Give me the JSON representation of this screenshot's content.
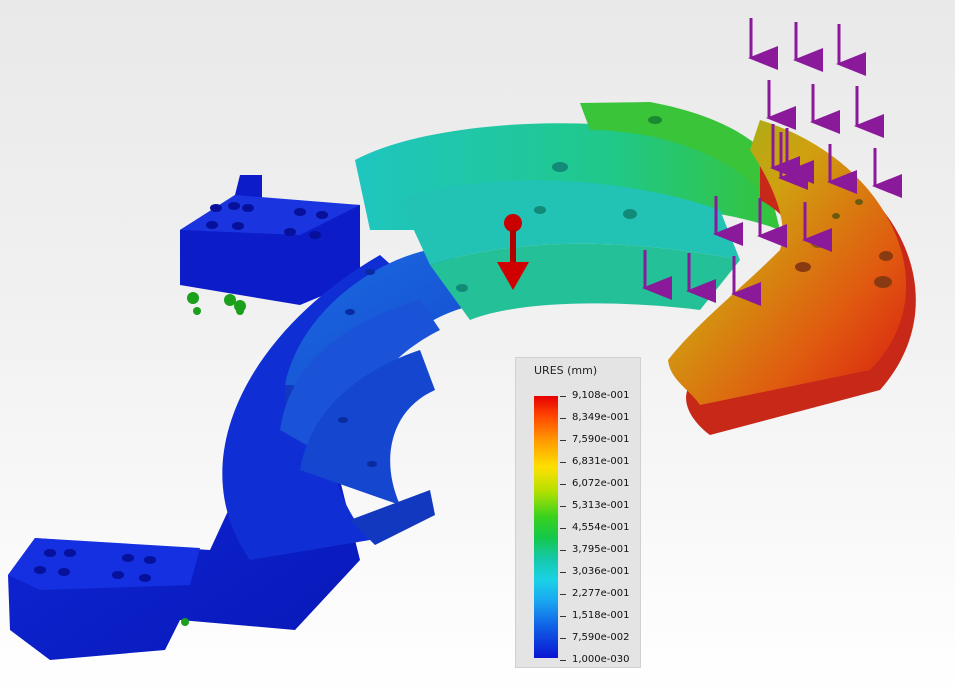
{
  "legend": {
    "title": "URES (mm)",
    "ticks": [
      "9,108e-001",
      "8,349e-001",
      "7,590e-001",
      "6,831e-001",
      "6,072e-001",
      "5,313e-001",
      "4,554e-001",
      "3,795e-001",
      "3,036e-001",
      "2,277e-001",
      "1,518e-001",
      "7,590e-002",
      "1,000e-030"
    ]
  },
  "colors": {
    "max": "#e60000",
    "min": "#0a14d2",
    "load_arrow": "#8a1a9a",
    "fixture": "#1aa01a",
    "remote_load": "#c80000"
  }
}
